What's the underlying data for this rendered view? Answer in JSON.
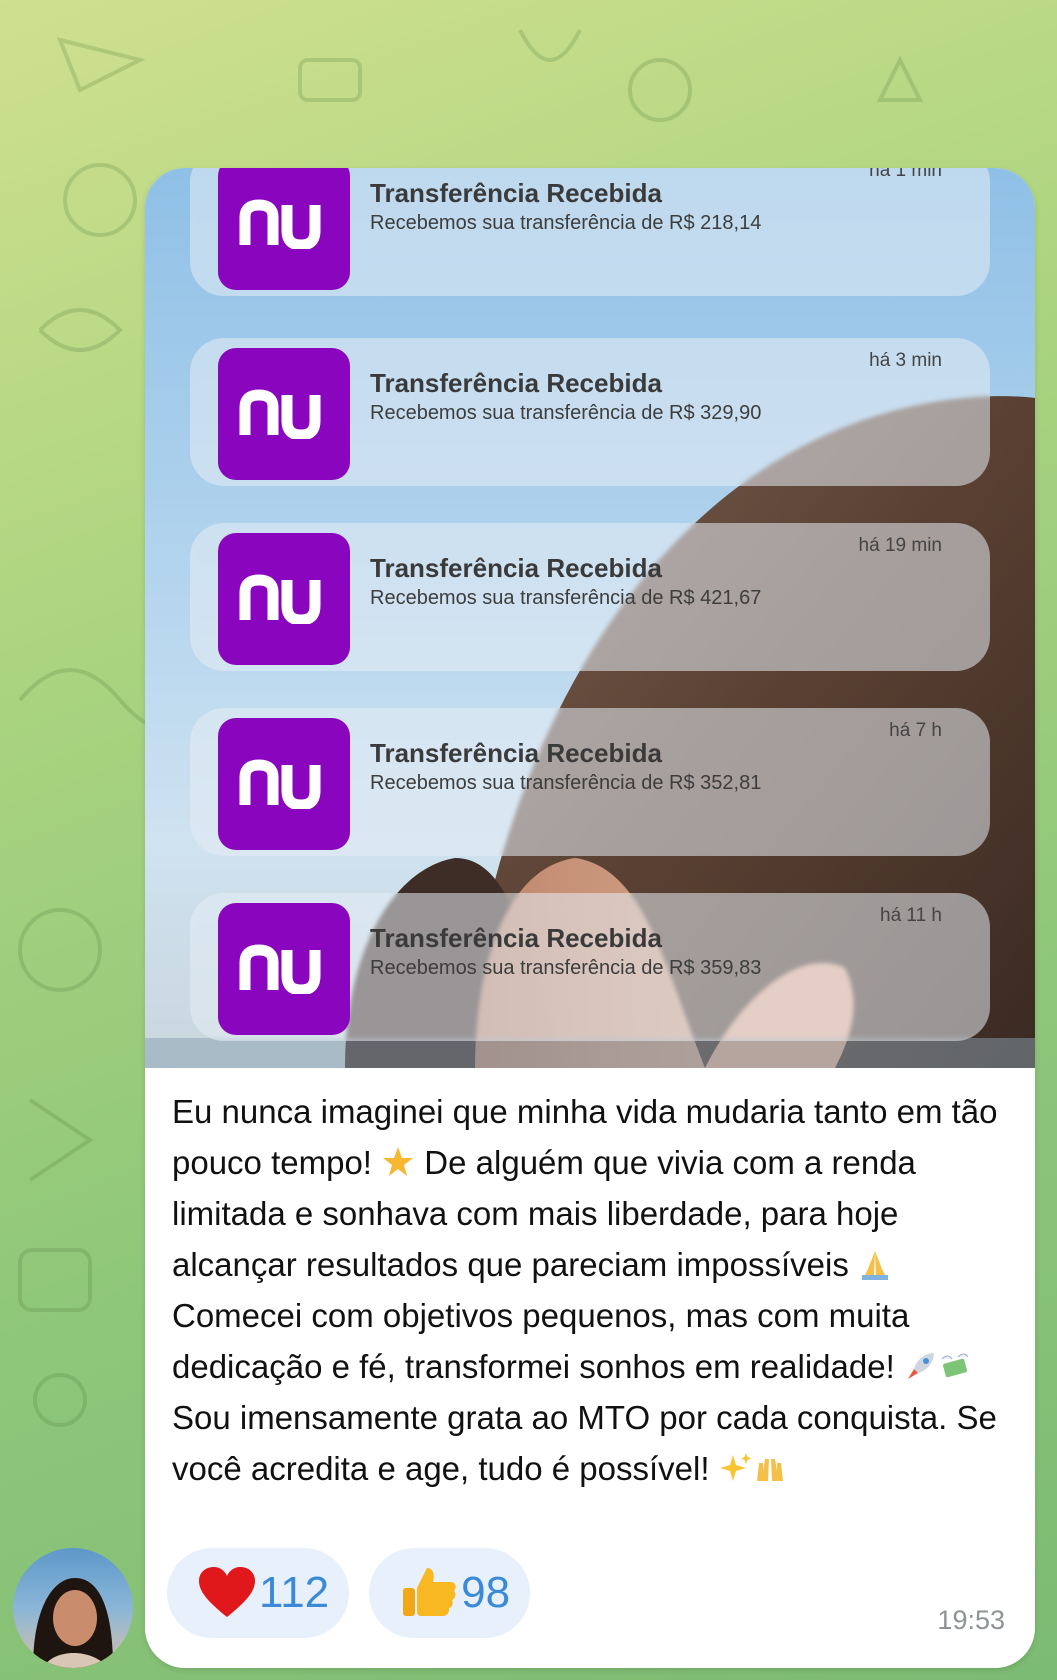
{
  "photo": {
    "notifications": [
      {
        "title": "Transferência Recebida",
        "body": "Recebemos sua transferência de R$ 218,14",
        "time": "há 1 min"
      },
      {
        "title": "Transferência Recebida",
        "body": "Recebemos sua transferência de R$ 329,90",
        "time": "há 3 min"
      },
      {
        "title": "Transferência Recebida",
        "body": "Recebemos sua transferência de R$ 421,67",
        "time": "há 19 min"
      },
      {
        "title": "Transferência Recebida",
        "body": "Recebemos sua transferência de R$ 352,81",
        "time": "há 7 h"
      },
      {
        "title": "Transferência Recebida",
        "body": "Recebemos sua transferência de R$ 359,83",
        "time": "há 11 h"
      }
    ],
    "logo_text": "nu",
    "logo_color": "#8a05be"
  },
  "message": {
    "caption_parts": [
      "Eu nunca imaginei que minha vida mudaria tanto em tão pouco tempo! ",
      " De alguém que vivia com a renda limitada e sonhava com mais liberdade, para hoje alcançar resultados que pareciam impossíveis ",
      " Comecei com objetivos pequenos, mas com muita dedicação e fé, transformei sonhos em realidade! ",
      " Sou imensamente grata ao MTO por cada conquista. Se você acredita e age, tudo é possível! "
    ],
    "emojis": [
      "star-emoji",
      "praying-hands-emoji",
      "rocket-emoji",
      "money-with-wings-emoji",
      "sparkles-emoji",
      "raising-hands-emoji"
    ],
    "reactions": [
      {
        "icon": "red-heart-icon",
        "count": "112"
      },
      {
        "icon": "thumbs-up-icon",
        "count": "98"
      }
    ],
    "time": "19:53"
  },
  "colors": {
    "reaction_count": "#3a8ad8",
    "nubank_purple": "#8a05be"
  }
}
